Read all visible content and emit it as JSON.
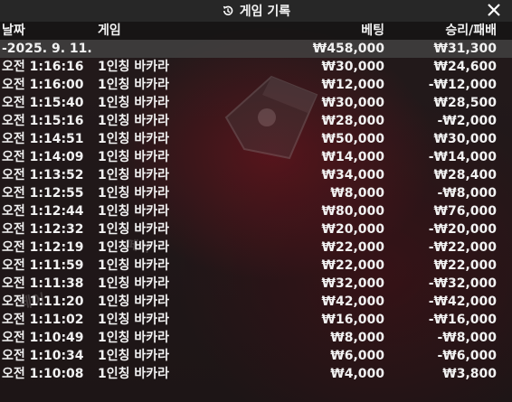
{
  "title": "게임 기록",
  "columns": {
    "date": "날짜",
    "game": "게임",
    "bet": "베팅",
    "result": "승리/패배"
  },
  "summary": {
    "date": "-2025. 9. 11.",
    "bet": "₩458,000",
    "result": "₩31,300"
  },
  "rows": [
    {
      "time": "오전 1:16:16",
      "game": "1인칭 바카라",
      "bet": "₩30,000",
      "result": "₩24,600"
    },
    {
      "time": "오전 1:16:00",
      "game": "1인칭 바카라",
      "bet": "₩12,000",
      "result": "-₩12,000"
    },
    {
      "time": "오전 1:15:40",
      "game": "1인칭 바카라",
      "bet": "₩30,000",
      "result": "₩28,500"
    },
    {
      "time": "오전 1:15:16",
      "game": "1인칭 바카라",
      "bet": "₩28,000",
      "result": "-₩2,000"
    },
    {
      "time": "오전 1:14:51",
      "game": "1인칭 바카라",
      "bet": "₩50,000",
      "result": "₩30,000"
    },
    {
      "time": "오전 1:14:09",
      "game": "1인칭 바카라",
      "bet": "₩14,000",
      "result": "-₩14,000"
    },
    {
      "time": "오전 1:13:52",
      "game": "1인칭 바카라",
      "bet": "₩34,000",
      "result": "₩28,400"
    },
    {
      "time": "오전 1:12:55",
      "game": "1인칭 바카라",
      "bet": "₩8,000",
      "result": "-₩8,000"
    },
    {
      "time": "오전 1:12:44",
      "game": "1인칭 바카라",
      "bet": "₩80,000",
      "result": "₩76,000"
    },
    {
      "time": "오전 1:12:32",
      "game": "1인칭 바카라",
      "bet": "₩20,000",
      "result": "-₩20,000"
    },
    {
      "time": "오전 1:12:19",
      "game": "1인칭 바카라",
      "bet": "₩22,000",
      "result": "-₩22,000"
    },
    {
      "time": "오전 1:11:59",
      "game": "1인칭 바카라",
      "bet": "₩22,000",
      "result": "₩22,000"
    },
    {
      "time": "오전 1:11:38",
      "game": "1인칭 바카라",
      "bet": "₩32,000",
      "result": "-₩32,000"
    },
    {
      "time": "오전 1:11:20",
      "game": "1인칭 바카라",
      "bet": "₩42,000",
      "result": "-₩42,000"
    },
    {
      "time": "오전 1:11:02",
      "game": "1인칭 바카라",
      "bet": "₩16,000",
      "result": "-₩16,000"
    },
    {
      "time": "오전 1:10:49",
      "game": "1인칭 바카라",
      "bet": "₩8,000",
      "result": "-₩8,000"
    },
    {
      "time": "오전 1:10:34",
      "game": "1인칭 바카라",
      "bet": "₩6,000",
      "result": "-₩6,000"
    },
    {
      "time": "오전 1:10:08",
      "game": "1인칭 바카라",
      "bet": "₩4,000",
      "result": "₩3,800"
    }
  ]
}
